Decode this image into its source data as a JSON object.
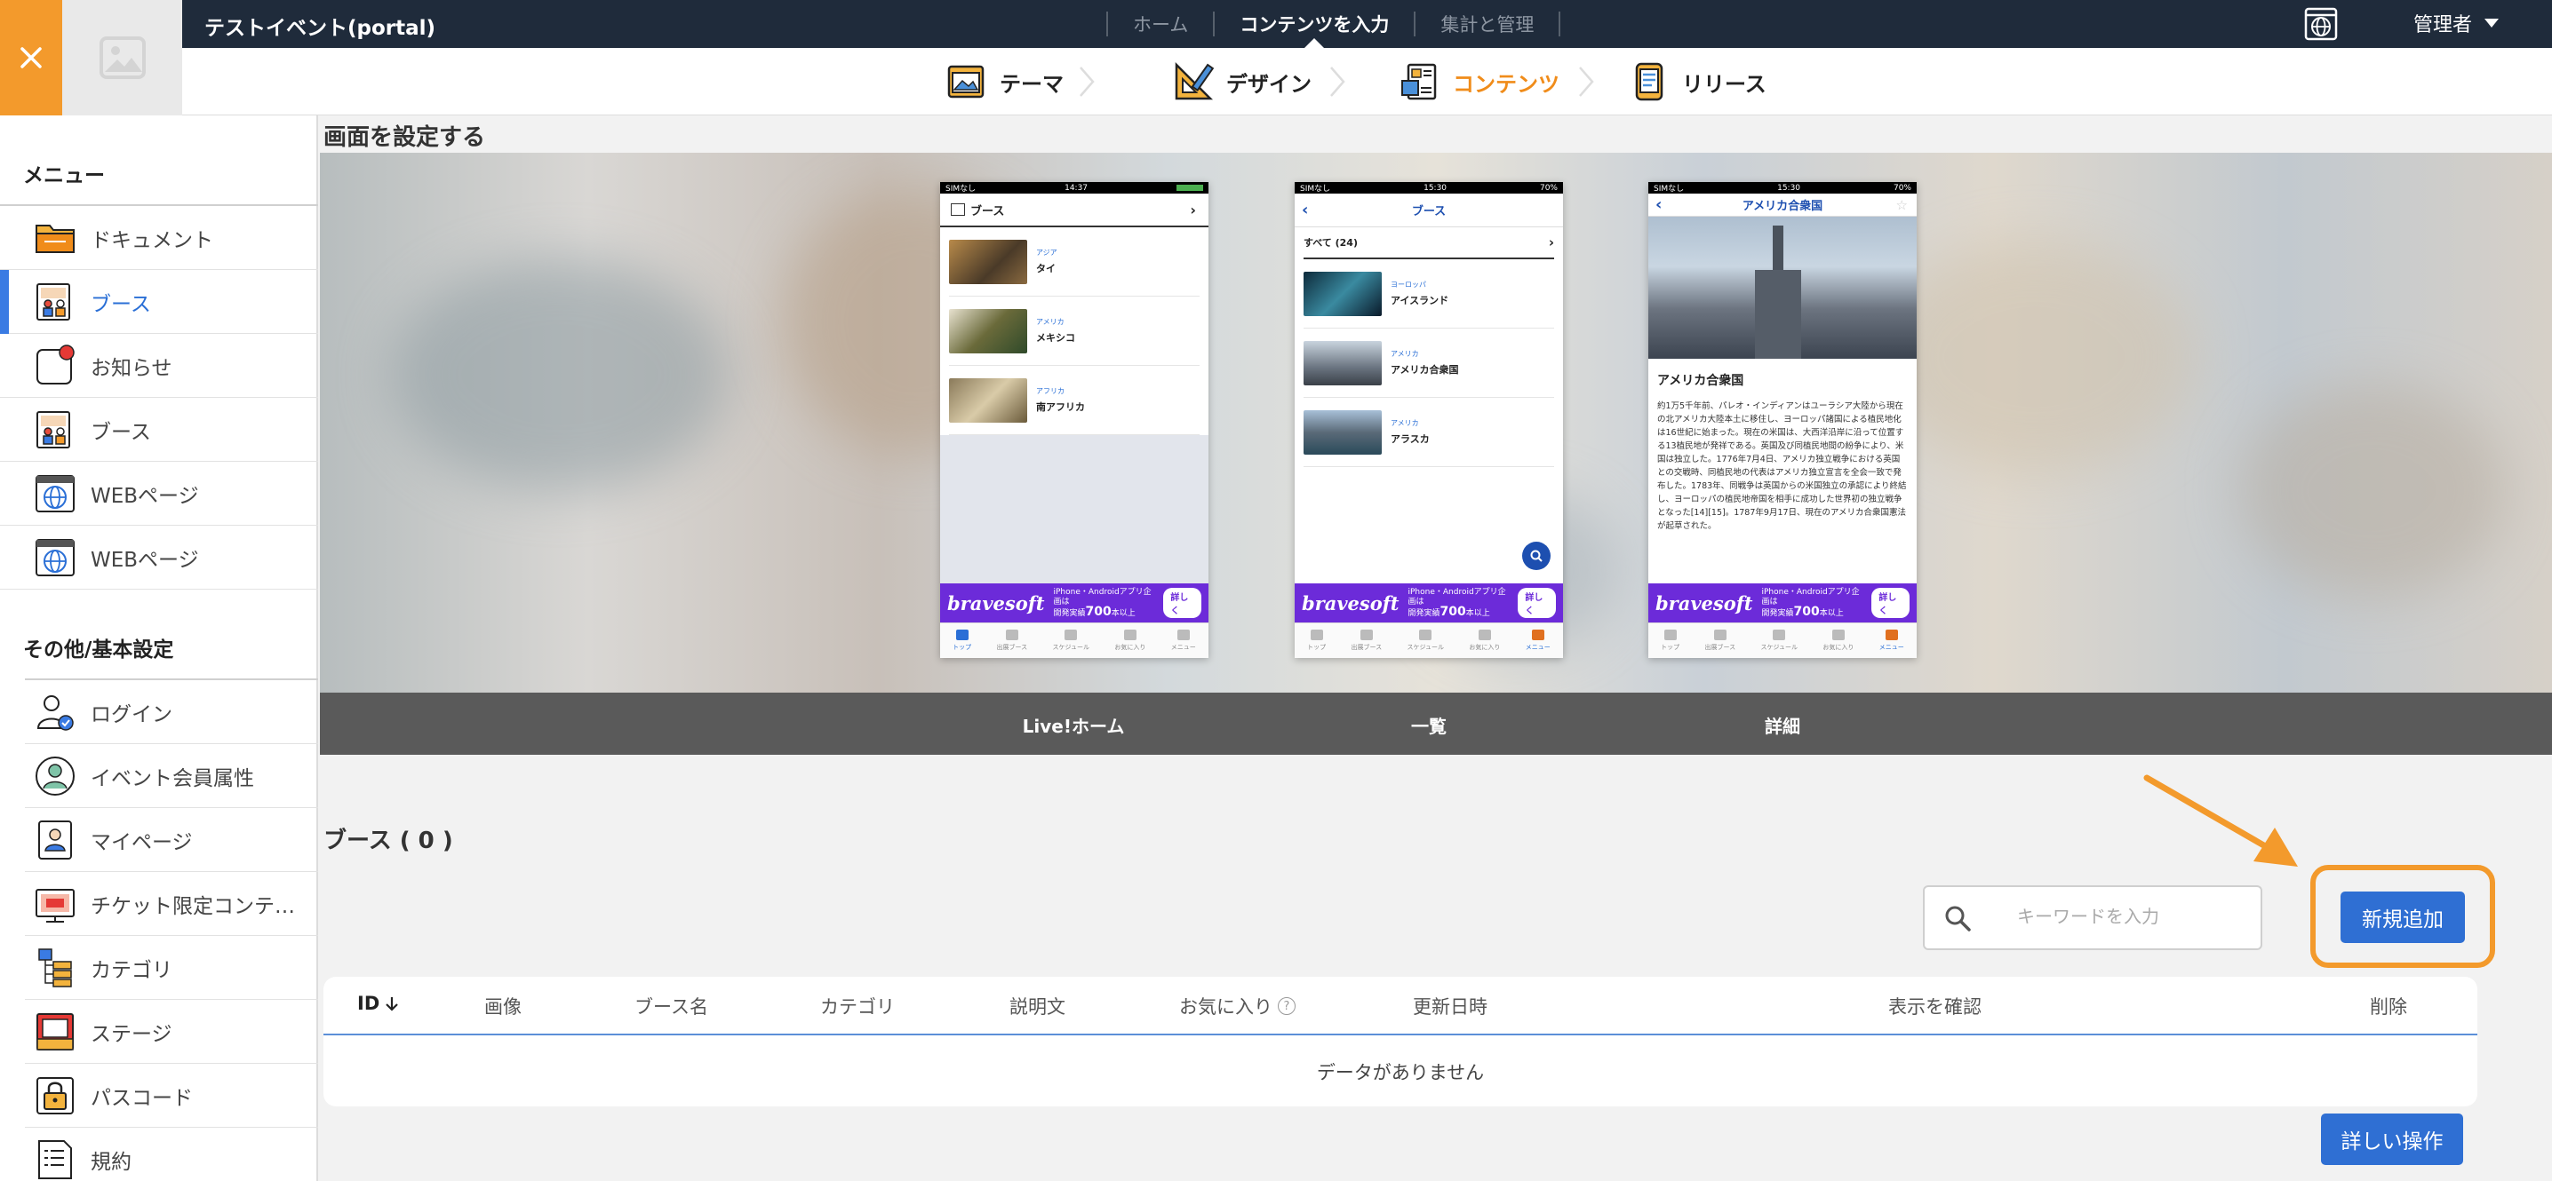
{
  "header": {
    "title": "テストイベント(portal)",
    "nav": [
      {
        "label": "ホーム",
        "active": false
      },
      {
        "label": "コンテンツを入力",
        "active": true
      },
      {
        "label": "集計と管理",
        "active": false
      }
    ],
    "user_label": "管理者",
    "globe_icon": "globe-icon",
    "close_icon": "close-icon",
    "logo_icon": "image-placeholder-icon"
  },
  "steps": [
    {
      "label": "テーマ",
      "icon": "theme-icon",
      "active": false
    },
    {
      "label": "デザイン",
      "icon": "design-icon",
      "active": false
    },
    {
      "label": "コンテンツ",
      "icon": "contents-icon",
      "active": true
    },
    {
      "label": "リリース",
      "icon": "release-icon",
      "active": false
    }
  ],
  "sidebar": {
    "menu_title": "メニュー",
    "menu_items": [
      {
        "label": "ドキュメント",
        "icon": "folder-icon",
        "active": false
      },
      {
        "label": "ブース",
        "icon": "booth-icon",
        "active": true
      },
      {
        "label": "お知らせ",
        "icon": "notification-icon",
        "active": false
      },
      {
        "label": "ブース",
        "icon": "booth-icon",
        "active": false
      },
      {
        "label": "WEBページ",
        "icon": "web-icon",
        "active": false
      },
      {
        "label": "WEBページ",
        "icon": "web-icon",
        "active": false
      }
    ],
    "other_title": "その他/基本設定",
    "other_items": [
      {
        "label": "ログイン",
        "icon": "login-icon"
      },
      {
        "label": "イベント会員属性",
        "icon": "member-icon"
      },
      {
        "label": "マイページ",
        "icon": "mypage-icon"
      },
      {
        "label": "チケット限定コンテ…",
        "icon": "ticket-icon"
      },
      {
        "label": "カテゴリ",
        "icon": "category-icon"
      },
      {
        "label": "ステージ",
        "icon": "stage-icon"
      },
      {
        "label": "パスコード",
        "icon": "lock-icon"
      },
      {
        "label": "規約",
        "icon": "terms-icon"
      }
    ]
  },
  "main": {
    "section_title": "画面を設定する",
    "preview_labels": [
      "Live!ホーム",
      "一覧",
      "詳細"
    ],
    "phone1": {
      "status_left": "SIMなし",
      "time": "14:37",
      "header": "ブース",
      "rows": [
        {
          "region": "アジア",
          "name": "タイ"
        },
        {
          "region": "アメリカ",
          "name": "メキシコ"
        },
        {
          "region": "アフリカ",
          "name": "南アフリカ"
        }
      ]
    },
    "phone2": {
      "status_left": "SIMなし",
      "time": "15:30",
      "status_right": "70%",
      "header": "ブース",
      "subheader": "すべて (24)",
      "rows": [
        {
          "region": "ヨーロッパ",
          "name": "アイスランド"
        },
        {
          "region": "アメリカ",
          "name": "アメリカ合衆国"
        },
        {
          "region": "アメリカ",
          "name": "アラスカ"
        }
      ]
    },
    "phone3": {
      "status_left": "SIMなし",
      "time": "15:30",
      "status_right": "70%",
      "header": "アメリカ合衆国",
      "title": "アメリカ合衆国",
      "body": "約1万5千年前、パレオ・インディアンはユーラシア大陸から現在の北アメリカ大陸本土に移住し、ヨーロッパ諸国による植民地化は16世紀に始まった。現在の米国は、大西洋沿岸に沿って位置する13植民地が発祥である。英国及び同植民地間の紛争により、米国は独立した。1776年7月4日、アメリカ独立戦争における英国との交戦時、同植民地の代表はアメリカ独立宣言を全会一致で発布した。1783年、同戦争は英国からの米国独立の承認により終結し、ヨーロッパの植民地帝国を相手に成功した世界初の独立戦争となった[14][15]。1787年9月17日、現在のアメリカ合衆国憲法が起草された。"
    },
    "banner": {
      "brand": "bravesoft",
      "line1": "iPhone・Androidアプリ企画は",
      "line2a": "開発実績",
      "line2b": "700",
      "line2c": "本以上",
      "more": "詳しく"
    },
    "tabbar": [
      "トップ",
      "出展ブース",
      "スケジュール",
      "お気に入り",
      "メニュー"
    ],
    "list_title": "ブース ( 0 )",
    "search_placeholder": "キーワードを入力",
    "add_button": "新規追加",
    "table_headers": [
      "ID",
      "画像",
      "ブース名",
      "カテゴリ",
      "説明文",
      "お気に入り",
      "更新日時",
      "表示を確認",
      "削除"
    ],
    "help_mark": "?",
    "empty_message": "データがありません",
    "detail_button": "詳しい操作",
    "accent_color": "#f39a2c",
    "primary_color": "#2f6fd3"
  }
}
